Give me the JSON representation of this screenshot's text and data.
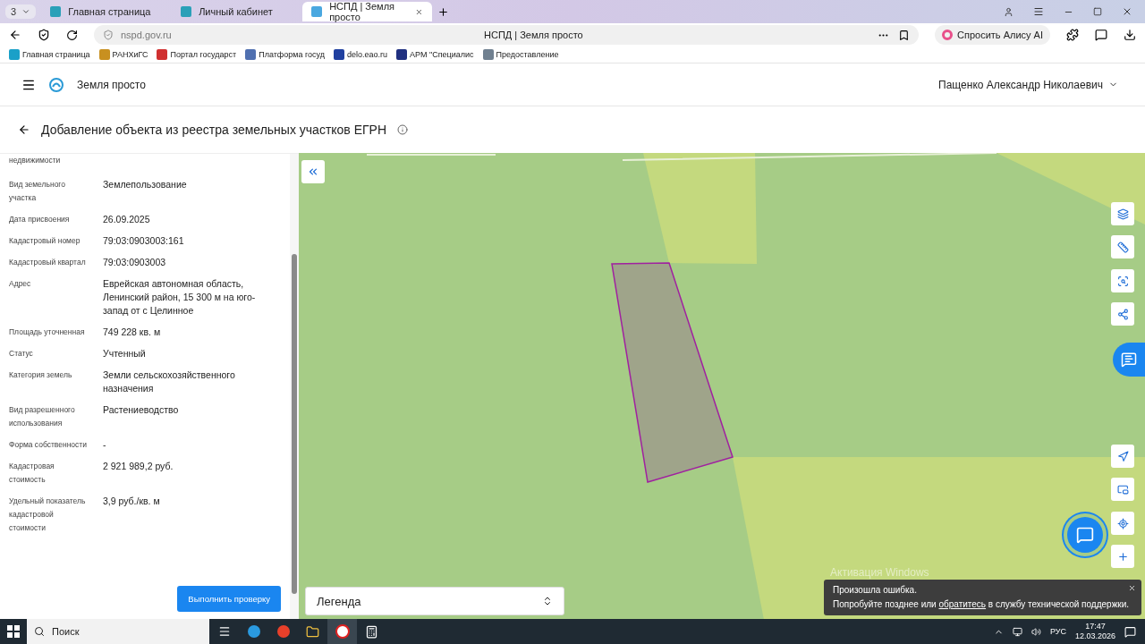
{
  "browser": {
    "tab_count": "3",
    "tabs": [
      {
        "title": "Главная страница",
        "selected": false
      },
      {
        "title": "Личный кабинет",
        "selected": false
      },
      {
        "title": "НСПД | Земля просто",
        "selected": true
      }
    ],
    "address": "nspd.gov.ru",
    "page_title": "НСПД | Земля просто",
    "alice": "Спросить Алису AI",
    "bookmarks": [
      "Главная страница",
      "РАНХиГС",
      "Портал государст",
      "Платформа госуд",
      "delo.eao.ru",
      "АРМ \"Специалис",
      "Предоставление"
    ]
  },
  "header": {
    "logo": "Земля просто",
    "user": "Пащенко Александр Николаевич"
  },
  "page": {
    "title": "Добавление объекта из реестра земельных участков ЕГРН"
  },
  "details": [
    {
      "label": "недвижимости"
    },
    {
      "label": "Вид земельного участка",
      "value": "Землепользование"
    },
    {
      "label": "Дата присвоения",
      "value": "26.09.2025"
    },
    {
      "label": "Кадастровый номер",
      "value": "79:03:0903003:161"
    },
    {
      "label": "Кадастровый квартал",
      "value": "79:03:0903003"
    },
    {
      "label": "Адрес",
      "value": "Еврейская автономная область, Ленинский район, 15 300 м на юго-запад от с Целинное"
    },
    {
      "label": "Площадь уточненная",
      "value": "749 228 кв. м"
    },
    {
      "label": "Статус",
      "value": "Учтенный"
    },
    {
      "label": "Категория земель",
      "value": "Земли сельскохозяйственного назначения"
    },
    {
      "label": "Вид разрешенного использования",
      "value": "Растениеводство"
    },
    {
      "label": "Форма собственности",
      "value": "-"
    },
    {
      "label": "Кадастровая стоимость",
      "value": "2 921 989,2 руб."
    },
    {
      "label": "Удельный показатель кадастровой стоимости",
      "value": "3,9 руб./кв. м"
    }
  ],
  "check_button": "Выполнить проверку",
  "legend": {
    "label": "Легенда"
  },
  "os_notice": "Активация Windows",
  "error_toast": {
    "title": "Произошла ошибка.",
    "before": "Попробуйте позднее или",
    "link": "обратитесь",
    "after": "в службу технической поддержки."
  },
  "taskbar": {
    "search": "Поиск",
    "language": "РУС",
    "time": "17:47",
    "date": "12.03.2026"
  }
}
